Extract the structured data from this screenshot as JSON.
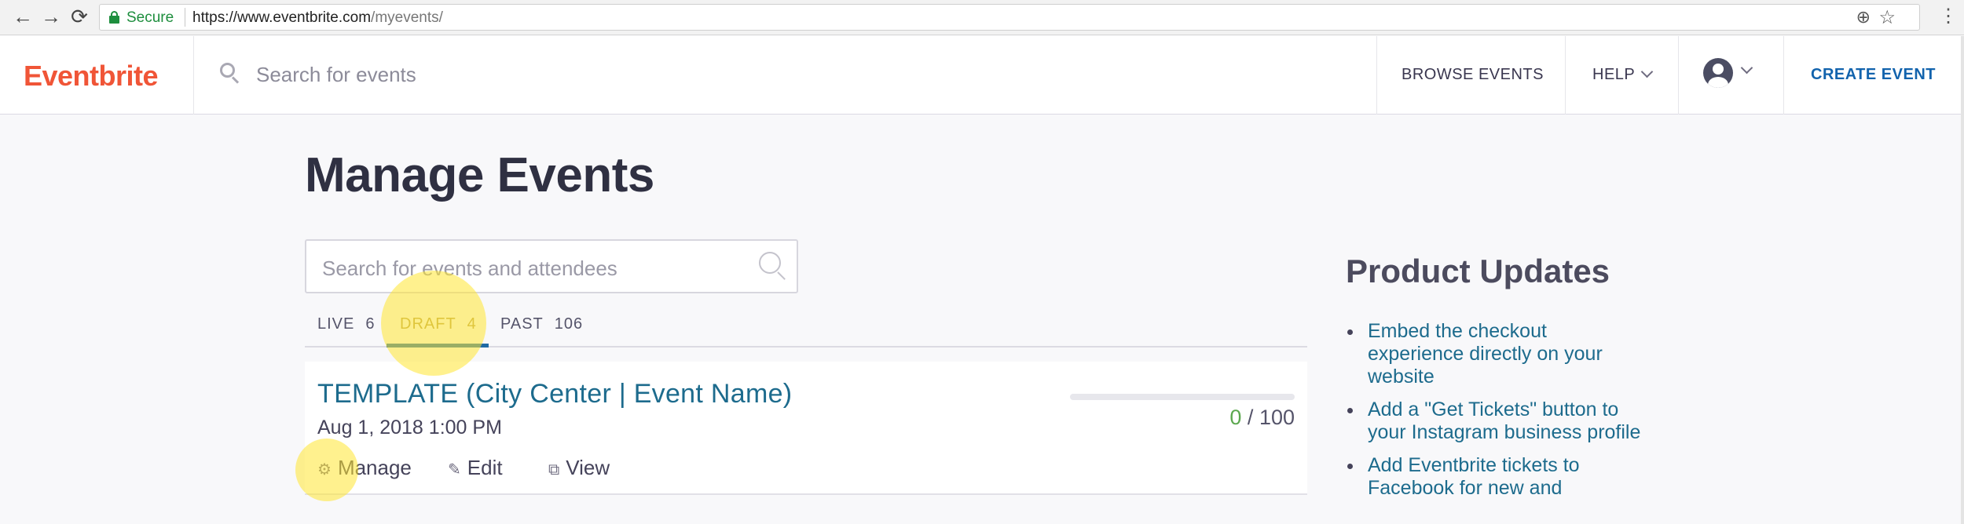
{
  "browser": {
    "secure_label": "Secure",
    "url_host": "https://www.eventbrite.com",
    "url_path": "/myevents/"
  },
  "header": {
    "logo": "Eventbrite",
    "search_placeholder": "Search for events",
    "browse": "BROWSE EVENTS",
    "help": "HELP",
    "create": "CREATE EVENT"
  },
  "main": {
    "title": "Manage Events",
    "search_placeholder": "Search for events and attendees",
    "tabs": [
      {
        "label": "LIVE",
        "count": "6"
      },
      {
        "label": "DRAFT",
        "count": "4"
      },
      {
        "label": "PAST",
        "count": "106"
      }
    ],
    "active_tab": "DRAFT",
    "events": [
      {
        "title": "TEMPLATE (City Center | Event Name)",
        "date": "Aug 1, 2018 1:00 PM",
        "sold": "0",
        "capacity": "100",
        "sold_fraction": 0,
        "actions": [
          "Manage",
          "Edit",
          "View"
        ]
      }
    ]
  },
  "product_updates": {
    "title": "Product Updates",
    "items": [
      "Embed the checkout experience directly on your website",
      "Add a \"Get Tickets\" button to your Instagram business profile",
      "Add Eventbrite tickets to Facebook for new and"
    ]
  },
  "colors": {
    "brand": "#f05537",
    "link": "#1d6b8d",
    "create": "#1263ad",
    "sold": "#5ca84f"
  }
}
